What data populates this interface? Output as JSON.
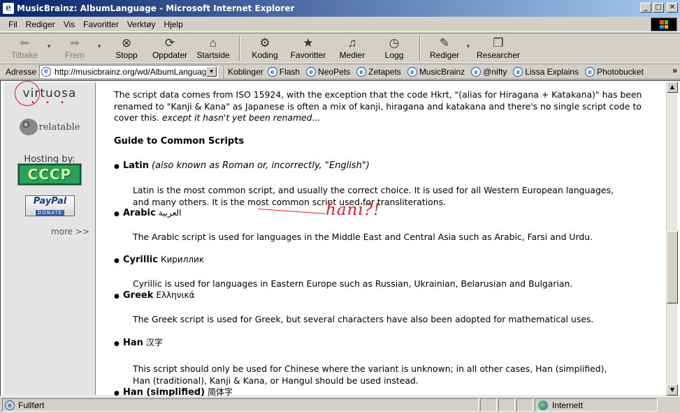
{
  "window": {
    "title": "MusicBrainz: AlbumLanguage - Microsoft Internet Explorer",
    "minimize": "_",
    "maximize": "□",
    "close": "✕"
  },
  "menu": [
    "Fil",
    "Rediger",
    "Vis",
    "Favoritter",
    "Verktøy",
    "Hjelp"
  ],
  "toolbar": {
    "back": "Tilbake",
    "forward": "Frem",
    "stop": "Stopp",
    "refresh": "Oppdater",
    "home": "Startside",
    "encoding": "Koding",
    "favorites": "Favoritter",
    "media": "Medier",
    "history": "Logg",
    "edit": "Rediger",
    "research": "Researcher"
  },
  "address": {
    "label": "Adresse",
    "url": "http://musicbrainz.org/wd/AlbumLanguage",
    "links_label": "Koblinger",
    "links": [
      "Flash",
      "NeoPets",
      "Zetapets",
      "MusicBrainz",
      "@nifty",
      "Lissa Explains",
      "Photobucket"
    ],
    "more": "»"
  },
  "sidebar": {
    "sponsor1": "virtuosa",
    "sponsor1_dots": "• • •",
    "sponsor2": "relatable",
    "hosting": "Hosting by:",
    "cccp": "CCCP",
    "paypal": "PayPal",
    "paypal_donate": "DONATE",
    "more": "more >>"
  },
  "content": {
    "intro": "The script data comes from ISO 15924, with the exception that the code Hkrt, \"(alias for Hiragana + Katakana)\" has been renamed to \"Kanji & Kana\" as Japanese is often a mix of kanji, hiragana and katakana and there's no single script code to cover this.",
    "intro_note": "except it hasn't yet been renamed...",
    "guide_heading": "Guide to Common Scripts",
    "scripts": [
      {
        "name": "Latin",
        "native": "",
        "alias": "(also known as Roman or, incorrectly, \"English\")",
        "description": "Latin is the most common script, and usually the correct choice. It is used for all Western European languages, and many others. It is the most common script used for transliterations."
      },
      {
        "name": "Arabic",
        "native": "العربية",
        "alias": "",
        "description": "The Arabic script is used for languages in the Middle East and Central Asia such as Arabic, Farsi and Urdu."
      },
      {
        "name": "Cyrillic",
        "native": "Кириллик",
        "alias": "",
        "description": "Cyrillic is used for languages in Eastern Europe such as Russian, Ukrainian, Belarusian and Bulgarian."
      },
      {
        "name": "Greek",
        "native": "Ελληνικά",
        "alias": "",
        "description": "The Greek script is used for Greek, but several characters have also been adopted for mathematical uses."
      },
      {
        "name": "Han",
        "native": "汉字",
        "alias": "",
        "description": "This script should only be used for Chinese where the variant is unknown; in all other cases, Han (simplified), Han (traditional), Kanji & Kana, or Hangul should be used instead."
      },
      {
        "name": "Han (simplified)",
        "native": "简体字",
        "alias": "",
        "description": ""
      }
    ],
    "handwritten_note": "hani?!"
  },
  "status": {
    "text": "Fullført",
    "zone": "Internett"
  },
  "colors": {
    "titlebar_start": "#0a246a",
    "titlebar_end": "#a6caf0",
    "chrome": "#d4d0c8",
    "sidebar": "#e4e4e4",
    "annotation": "#e02020"
  }
}
